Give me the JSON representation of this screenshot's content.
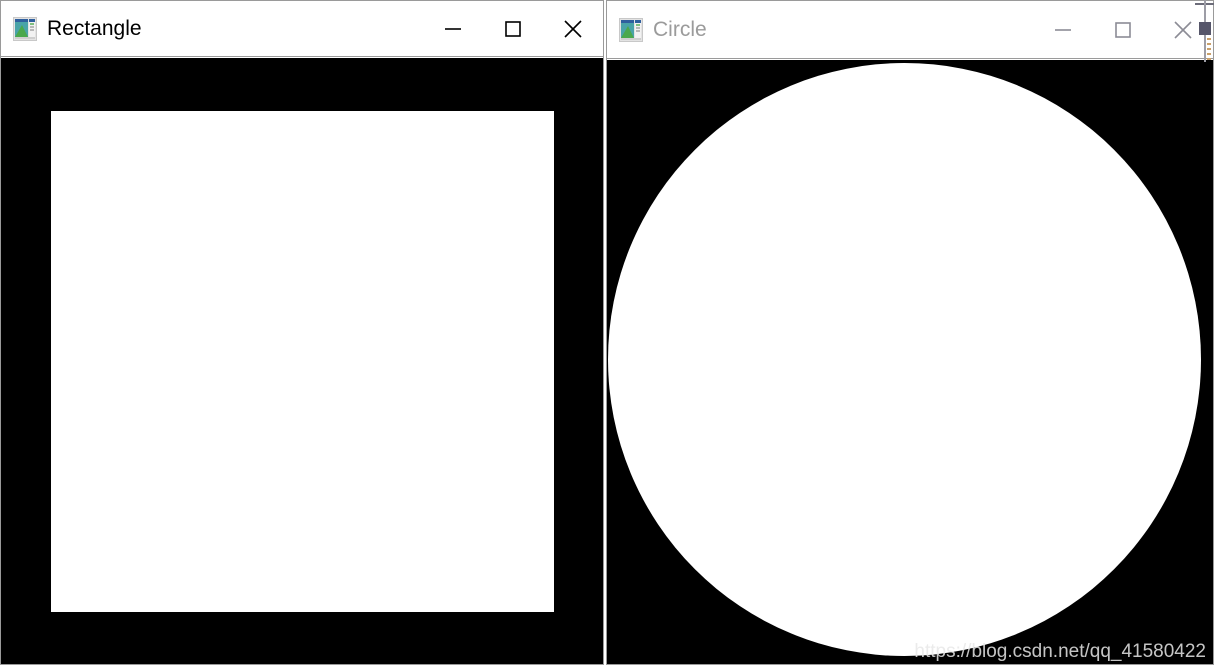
{
  "watermark": {
    "text": "https://blog.csdn.net/qq_41580422"
  },
  "windows": [
    {
      "id": "rectangle-window",
      "title": "Rectangle",
      "state": "active",
      "icon": "opencv-highgui-icon",
      "controls": {
        "minimize_label": "Minimize",
        "maximize_label": "Maximize",
        "close_label": "Close"
      },
      "canvas": {
        "background_color": "#000000",
        "shape": "rectangle",
        "shape_color": "#ffffff"
      }
    },
    {
      "id": "circle-window",
      "title": "Circle",
      "state": "inactive",
      "icon": "opencv-highgui-icon",
      "controls": {
        "minimize_label": "Minimize",
        "maximize_label": "Maximize",
        "close_label": "Close"
      },
      "canvas": {
        "background_color": "#000000",
        "shape": "circle",
        "shape_color": "#ffffff"
      }
    }
  ]
}
